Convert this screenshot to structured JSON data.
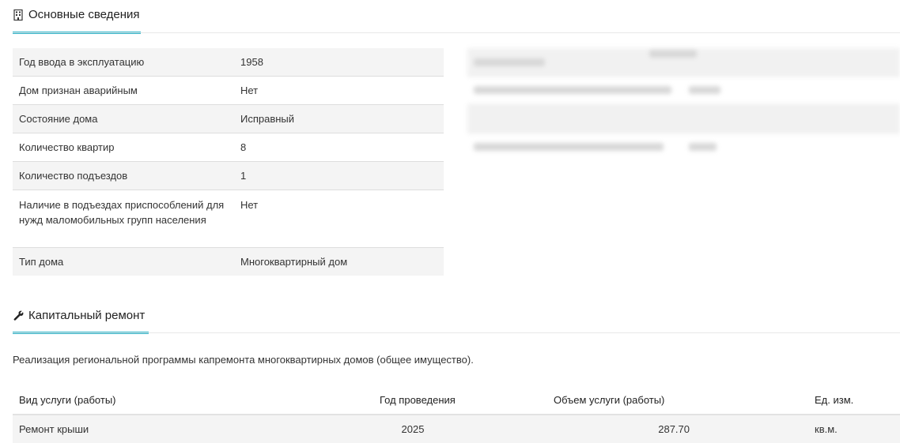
{
  "section_basic": {
    "title": "Основные сведения",
    "icon": "building-icon",
    "rows": [
      {
        "label": "Год ввода в эксплуатацию",
        "value": "1958"
      },
      {
        "label": "Дом признан аварийным",
        "value": "Нет"
      },
      {
        "label": "Состояние дома",
        "value": "Исправный"
      },
      {
        "label": "Количество квартир",
        "value": "8"
      },
      {
        "label": "Количество подъездов",
        "value": "1"
      },
      {
        "label": "Наличие в подъездах приспособлений для нужд маломобильных групп населения",
        "value": "Нет"
      },
      {
        "label": "Тип дома",
        "value": "Многоквартирный дом"
      }
    ]
  },
  "section_repair": {
    "title": "Капитальный ремонт",
    "icon": "wrench-icon",
    "description": "Реализация региональной программы капремонта многоквартирных домов (общее имущество).",
    "columns": [
      "Вид услуги (работы)",
      "Год проведения",
      "Объем услуги (работы)",
      "Ед. изм."
    ],
    "rows": [
      {
        "service": "Ремонт крыши",
        "year": "2025",
        "volume": "287.70",
        "unit": "кв.м."
      }
    ]
  },
  "colors": {
    "accent": "#2ab3c9",
    "row_shade": "#f4f4f4"
  }
}
